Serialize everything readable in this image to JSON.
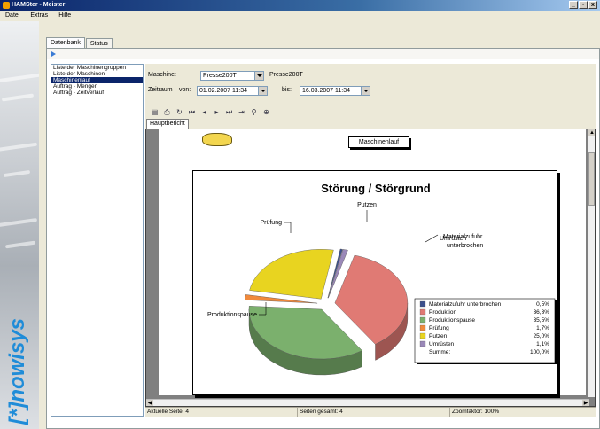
{
  "window": {
    "title": "HAMSter - Meister",
    "controls": [
      "_",
      "▫",
      "x"
    ]
  },
  "menu": [
    "Datei",
    "Extras",
    "Hilfe"
  ],
  "brand": {
    "logo_text": "[*]nowisys"
  },
  "tabs": [
    "Datenbank",
    "Status"
  ],
  "reports": {
    "items": [
      "Liste der Maschinengruppen",
      "Liste der Maschinen",
      "Maschinenlauf",
      "Auftrag - Mengen",
      "Auftrag - Zeitverlauf"
    ],
    "selected_index": 2
  },
  "params": {
    "machine_label": "Maschine:",
    "machine_value": "Presse200T",
    "machine_display": "Presse200T",
    "range_label": "Zeitraum",
    "from_label": "von:",
    "from_value": "01.02.2007 11:34",
    "to_label": "bis:",
    "to_value": "16.03.2007 11:34"
  },
  "toolbar_icons": [
    "export-icon",
    "print-icon",
    "refresh-icon",
    "first-page-icon",
    "prev-page-icon",
    "next-page-icon",
    "last-page-icon",
    "goto-page-icon",
    "find-icon",
    "zoom-icon"
  ],
  "report_tab": "Hauptbericht",
  "report": {
    "header": "Maschinenlauf",
    "chart_data": {
      "type": "pie",
      "title": "Störung / Störgrund",
      "slices": [
        {
          "label": "Materialzufuhr unterbrochen",
          "value": 0.5,
          "value_text": "0,5%",
          "color": "#3b4f8c"
        },
        {
          "label": "Produktion",
          "value": 36.3,
          "value_text": "36,3%",
          "color": "#e07a74"
        },
        {
          "label": "Produktionspause",
          "value": 35.5,
          "value_text": "35,5%",
          "color": "#7bb06d"
        },
        {
          "label": "Prüfung",
          "value": 1.7,
          "value_text": "1,7%",
          "color": "#f08a3c"
        },
        {
          "label": "Putzen",
          "value": 25.0,
          "value_text": "25,0%",
          "color": "#e8d420"
        },
        {
          "label": "Umrüsten",
          "value": 1.1,
          "value_text": "1,1%",
          "color": "#9a88b8"
        }
      ],
      "total_label": "Summe:",
      "total_value": "100,0%",
      "outside_labels": {
        "putzen": "Putzen",
        "pruefung": "Prüfung",
        "produktionspause": "Produktionspause",
        "umruesten": "Umrüsten",
        "materialzufuhr_1": "Materialzufuhr",
        "materialzufuhr_2": "unterbrochen"
      },
      "legend": "bottom-right"
    }
  },
  "status": {
    "current_page": "Aktuelle Seite: 4",
    "total_pages": "Seiten gesamt: 4",
    "zoom": "Zoomfaktor: 100%"
  }
}
